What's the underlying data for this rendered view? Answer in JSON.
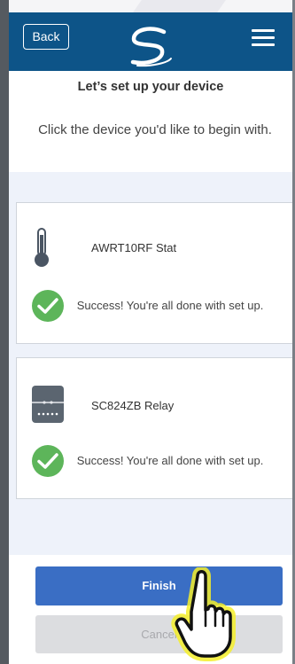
{
  "header": {
    "back_label": "Back",
    "logo_icon": "swirl-logo-icon",
    "menu_icon": "hamburger-menu-icon",
    "bg_color": "#0d5488"
  },
  "page": {
    "title": "Let’s set up your device",
    "subtitle": "Click the device you'd like to begin with."
  },
  "devices": [
    {
      "name": "AWRT10RF Stat",
      "icon": "thermometer-icon",
      "status_icon": "check-circle-icon",
      "status_text": "Success! You're all done with set up."
    },
    {
      "name": "SC824ZB Relay",
      "icon": "relay-box-icon",
      "status_icon": "check-circle-icon",
      "status_text": "Success! You're all done with set up."
    }
  ],
  "actions": {
    "finish_label": "Finish",
    "cancel_label": "Cancel",
    "finish_color": "#3a6ec4"
  },
  "overlay": {
    "pointer_icon": "hand-pointer-icon",
    "highlight_color": "#f5ef2a"
  }
}
